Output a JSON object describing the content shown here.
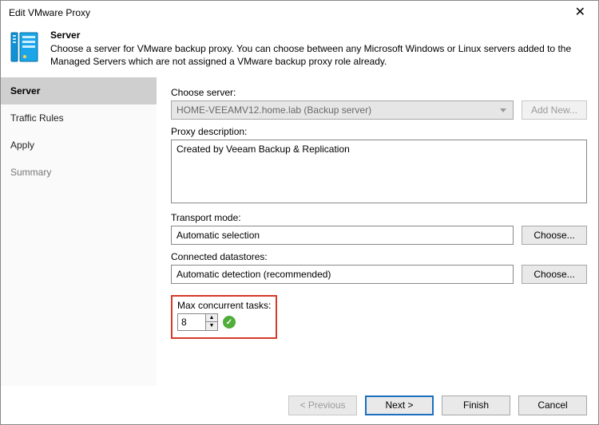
{
  "window": {
    "title": "Edit VMware Proxy"
  },
  "header": {
    "title": "Server",
    "subtitle": "Choose a server for VMware backup proxy. You can choose between any Microsoft Windows or Linux servers added to the Managed Servers which are not assigned a VMware backup proxy role already."
  },
  "sidebar": {
    "items": [
      {
        "label": "Server",
        "active": true
      },
      {
        "label": "Traffic Rules",
        "active": false
      },
      {
        "label": "Apply",
        "active": false
      },
      {
        "label": "Summary",
        "active": false
      }
    ]
  },
  "form": {
    "choose_server_label": "Choose server:",
    "choose_server_value": "HOME-VEEAMV12.home.lab (Backup server)",
    "add_new_label": "Add New...",
    "proxy_desc_label": "Proxy description:",
    "proxy_desc_value": "Created by Veeam Backup & Replication",
    "transport_mode_label": "Transport mode:",
    "transport_mode_value": "Automatic selection",
    "choose_label": "Choose...",
    "datastores_label": "Connected datastores:",
    "datastores_value": "Automatic detection (recommended)",
    "max_tasks_label": "Max concurrent tasks:",
    "max_tasks_value": "8"
  },
  "footer": {
    "previous": "< Previous",
    "next": "Next >",
    "finish": "Finish",
    "cancel": "Cancel"
  }
}
